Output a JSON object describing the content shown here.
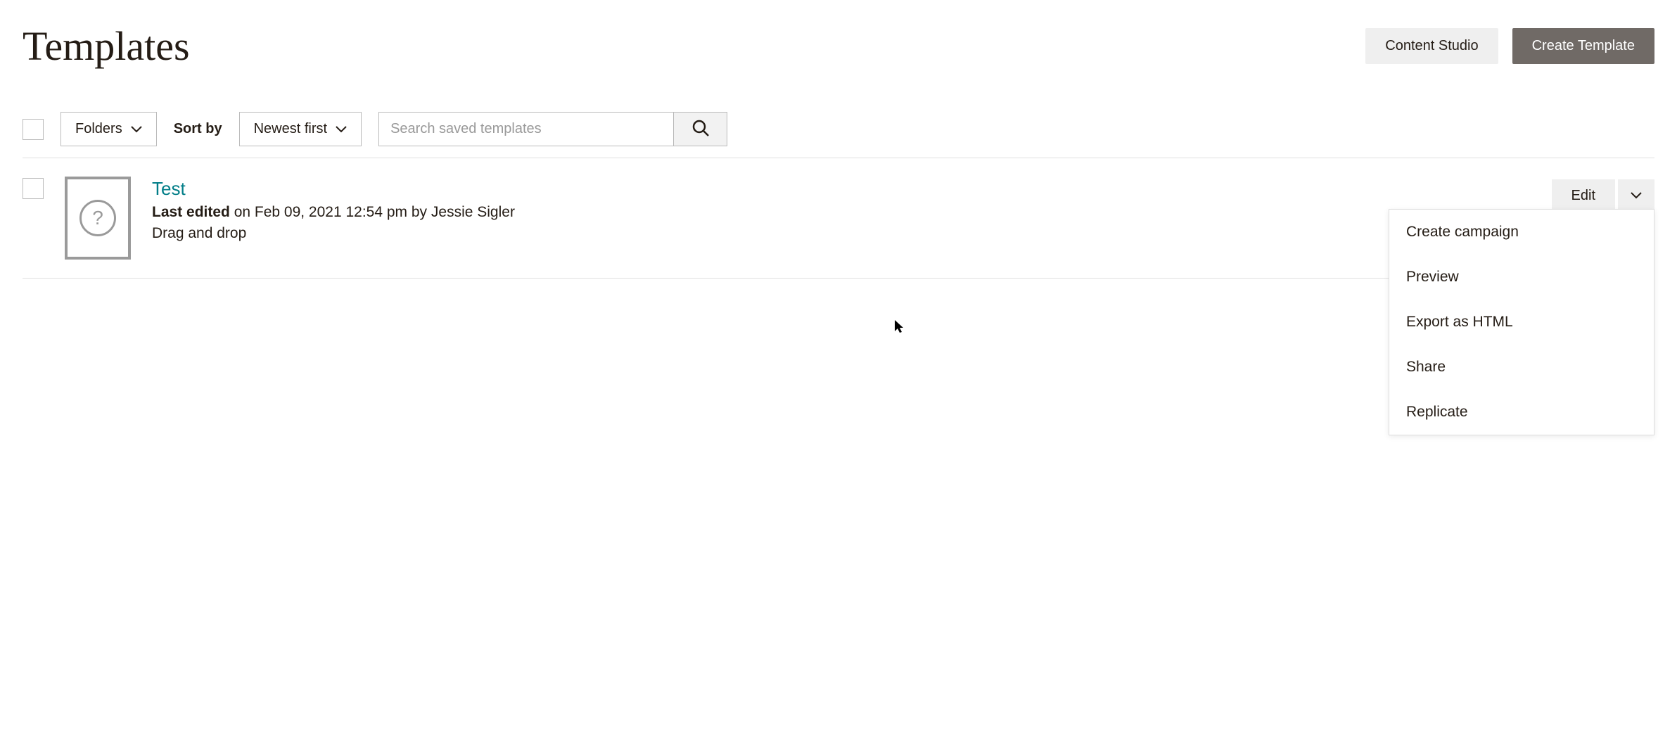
{
  "header": {
    "title": "Templates",
    "content_studio_label": "Content Studio",
    "create_template_label": "Create Template"
  },
  "toolbar": {
    "folders_label": "Folders",
    "sort_by_label": "Sort by",
    "sort_selected": "Newest first",
    "search_placeholder": "Search saved templates"
  },
  "templates": [
    {
      "name": "Test",
      "last_edited_prefix": "Last edited",
      "last_edited_suffix": " on Feb 09, 2021 12:54 pm by Jessie Sigler",
      "type": "Drag and drop",
      "edit_label": "Edit"
    }
  ],
  "dropdown": {
    "items": [
      "Create campaign",
      "Preview",
      "Export as HTML",
      "Share",
      "Replicate"
    ]
  }
}
